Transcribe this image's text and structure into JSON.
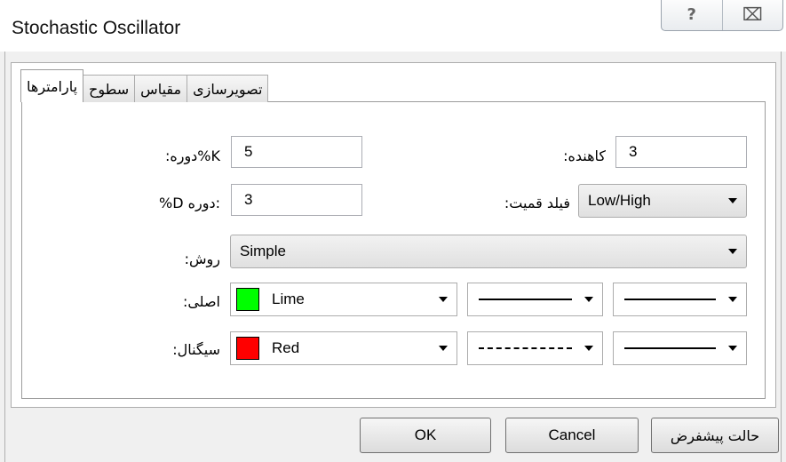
{
  "window": {
    "title": "Stochastic Oscillator",
    "help_glyph": "?",
    "close_glyph": "⌧"
  },
  "tabs": [
    {
      "label": "پارامترها",
      "active": true
    },
    {
      "label": "سطوح",
      "active": false
    },
    {
      "label": "مقیاس",
      "active": false
    },
    {
      "label": "تصویرسازی",
      "active": false
    }
  ],
  "params": {
    "k_period": {
      "label": ":دوره%K",
      "value": "5"
    },
    "d_period": {
      "label": "%D دوره:",
      "value": "3"
    },
    "slowing": {
      "label": ":کاهنده",
      "value": "3"
    },
    "price_field": {
      "label": ":فیلد قمیت",
      "value": "Low/High"
    },
    "method": {
      "label": ":روش",
      "value": "Simple"
    },
    "main": {
      "label": ":اصلی",
      "color_name": "Lime",
      "color": "#00ff00",
      "style": "solid",
      "width": "solid"
    },
    "signal": {
      "label": ":سیگنال",
      "color_name": "Red",
      "color": "#ff0000",
      "style": "dashed",
      "width": "solid"
    }
  },
  "buttons": {
    "ok": "OK",
    "cancel": "Cancel",
    "reset": "حالت پیشفرض"
  }
}
